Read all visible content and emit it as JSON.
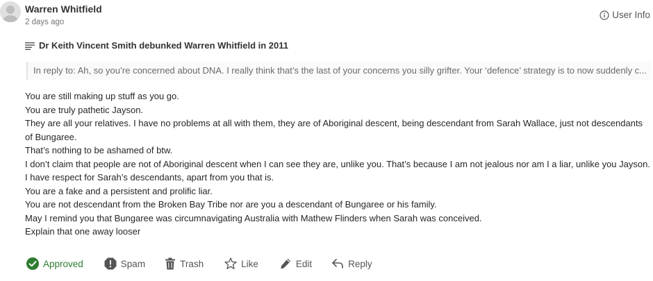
{
  "comment": {
    "author": "Warren Whitfield",
    "time_ago": "2 days ago",
    "user_info_label": "User Info",
    "post_title": "Dr Keith Vincent Smith debunked Warren Whitfield in 2011",
    "in_reply_to": "In reply to: Ah, so you’re concerned about DNA. I really think that’s the last of your concerns you silly grifter. Your ‘defence’ strategy is to now suddenly c...",
    "body_lines": [
      "You are still making up stuff as you go.",
      "You are truly pathetic Jayson.",
      "They are all your relatives. I have no problems at all with them, they are of Aboriginal descent, being descendant from Sarah Wallace, just not descendants of Bungaree.",
      "That’s nothing to be ashamed of btw.",
      "I don’t claim that people are not of Aboriginal descent when I can see they are, unlike you. That’s because I am not jealous nor am I a liar, unlike you Jayson.",
      "I have respect for Sarah’s descendants, apart from you that is.",
      "You are a fake and a persistent and prolific liar.",
      "You are not descendant from the Broken Bay Tribe nor are you a descendant of Bungaree or his family.",
      "May I remind you that Bungaree was circumnavigating Australia with Mathew Flinders when Sarah was conceived.",
      "Explain that one away looser"
    ]
  },
  "actions": {
    "approved": "Approved",
    "spam": "Spam",
    "trash": "Trash",
    "like": "Like",
    "edit": "Edit",
    "reply": "Reply"
  },
  "colors": {
    "approved": "#2e7d32",
    "action_text": "#555555",
    "quote_border": "#e2e2e2"
  },
  "icons": {
    "avatar": "avatar-placeholder",
    "user_info": "info-circle-icon",
    "post_title": "post-lines-icon",
    "approved": "check-circle-icon",
    "spam": "spam-alert-icon",
    "trash": "trash-icon",
    "like": "star-icon",
    "edit": "pencil-icon",
    "reply": "reply-arrow-icon"
  }
}
